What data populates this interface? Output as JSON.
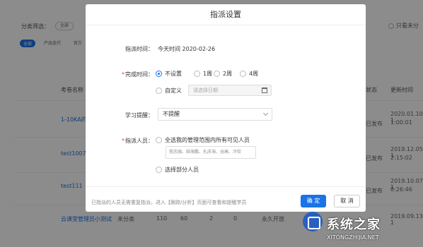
{
  "background": {
    "filter_label": "分类筛选：",
    "filter_all": "全部",
    "only_unlabeled": "只看未分",
    "tabs": [
      "全部",
      "产品迭代",
      "官方"
    ],
    "headers": {
      "exam_name": "考卷名称",
      "status": "状态",
      "updated": "更新时间"
    },
    "rows": [
      {
        "name": "1-10KA的",
        "status": "已发布",
        "date": "2020.01.10 1",
        "time": "1:00:01"
      },
      {
        "name": "test1007",
        "status": "已发布",
        "date": "2019.12.05 1",
        "time": "2:15:02"
      },
      {
        "name": "test111",
        "status": "已发布",
        "date": "2019.10.07 1",
        "time": "0:26:46"
      },
      {
        "name": "云课堂管理员小测试",
        "col2": "未分类",
        "col3": "110",
        "col4": "60",
        "col5": "2",
        "col6": "0",
        "status": "永久开放",
        "date": "2019.09.13 1"
      }
    ]
  },
  "modal": {
    "title": "指派设置",
    "assign_time": {
      "label": "指派时间：",
      "value": "今天时间 2020-02-26"
    },
    "complete_time": {
      "label": "完成时间：",
      "options": [
        "不设置",
        "1周",
        "2周",
        "4周"
      ],
      "custom_label": "自定义",
      "date_placeholder": "请选择日期",
      "selected": "不设置"
    },
    "reminder": {
      "label": "学习提醒：",
      "value": "不提醒"
    },
    "assignee": {
      "label": "指派人员：",
      "option_all": "全选我的管理范围内所有可见人员",
      "chips": "苑志强、田海鹏、孔庆海、谷高、冷钦",
      "option_partial": "选择部分人员"
    },
    "footer_note": "已指派的人员无需重复指派，进入【跟踪/分析】页面可查看和提醒学员",
    "ok_label": "确 定",
    "cancel_label": "取 消"
  },
  "watermark": {
    "name": "系统之家",
    "url": "XITONGZHIJIA.NET"
  },
  "colors": {
    "accent": "#1a73e8",
    "required": "#e64340"
  }
}
